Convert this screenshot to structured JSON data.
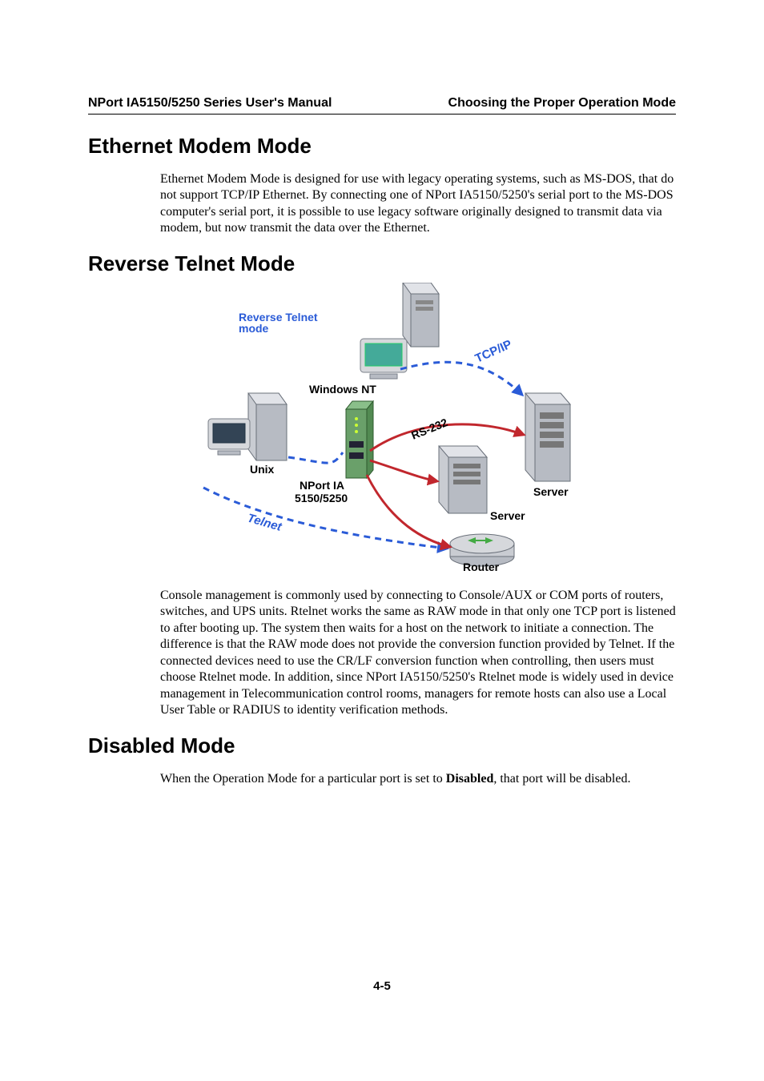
{
  "runhead": {
    "left": "NPort IA5150/5250 Series User's Manual",
    "right": "Choosing the Proper Operation Mode"
  },
  "sections": {
    "ethernet": {
      "title": "Ethernet Modem Mode",
      "body": "Ethernet Modem Mode is designed for use with legacy operating systems, such as MS-DOS, that do not support TCP/IP Ethernet. By connecting one of NPort IA5150/5250's serial port to the MS-DOS computer's serial port, it is possible to use legacy software originally designed to transmit data via modem, but now transmit the data over the Ethernet."
    },
    "reverse": {
      "title": "Reverse Telnet Mode",
      "body": "Console management is commonly used by connecting to Console/AUX or COM ports of routers, switches, and UPS units. Rtelnet works the same as RAW mode in that only one TCP port is listened to after booting up. The system then waits for a host on the network to initiate a connection. The difference is that the RAW mode does not provide the conversion function provided by Telnet. If the connected devices need to use the CR/LF conversion function when controlling, then users must choose Rtelnet mode. In addition, since NPort IA5150/5250's Rtelnet mode is widely used in device management in Telecommunication control rooms, managers for remote hosts can also use a Local User Table or RADIUS to identity verification methods."
    },
    "disabled": {
      "title": "Disabled Mode",
      "body_prefix": "When the Operation Mode for a particular port is set to ",
      "body_bold": "Disabled",
      "body_suffix": ", that port will be disabled."
    }
  },
  "figure": {
    "title1": "Reverse Telnet",
    "title2": "mode",
    "labels": {
      "windows_nt": "Windows NT",
      "unix": "Unix",
      "tcpip": "TCP/IP",
      "rs232": "RS-232",
      "telnet": "Telnet",
      "nport1": "NPort IA",
      "nport2": "5150/5250",
      "server": "Server",
      "router": "Router"
    }
  },
  "pagenum": "4-5"
}
